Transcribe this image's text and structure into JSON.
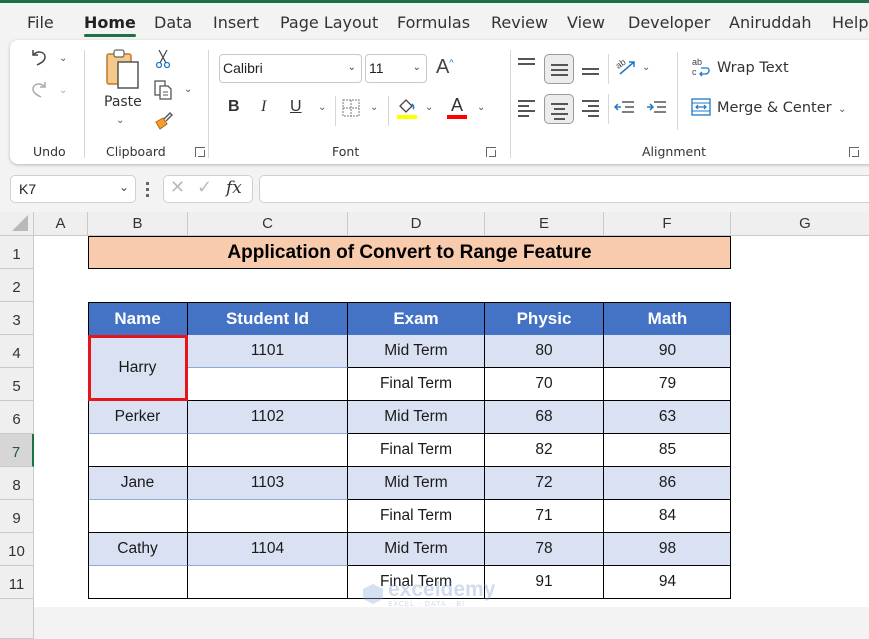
{
  "tabs": [
    {
      "label": "File",
      "active": false
    },
    {
      "label": "Home",
      "active": true
    },
    {
      "label": "Data",
      "active": false
    },
    {
      "label": "Insert",
      "active": false
    },
    {
      "label": "Page Layout",
      "active": false
    },
    {
      "label": "Formulas",
      "active": false
    },
    {
      "label": "Review",
      "active": false
    },
    {
      "label": "View",
      "active": false
    },
    {
      "label": "Developer",
      "active": false
    },
    {
      "label": "Aniruddah",
      "active": false
    },
    {
      "label": "Help",
      "active": false
    }
  ],
  "ribbon": {
    "undo": {
      "group_label": "Undo",
      "undo_icon": "undo-icon",
      "redo_icon": "redo-icon"
    },
    "clipboard": {
      "group_label": "Clipboard",
      "paste_label": "Paste",
      "cut_icon": "scissors-icon",
      "copy_icon": "copy-icon",
      "format_painter_icon": "paintbrush-icon"
    },
    "font": {
      "group_label": "Font",
      "font_name": "Calibri",
      "font_size": "11",
      "bold": "B",
      "italic": "I",
      "underline": "U",
      "grow_font": "A",
      "shrink_font": "A",
      "font_color_letter": "A",
      "fill_color": "#ffff00",
      "font_color": "#ff0000"
    },
    "alignment": {
      "group_label": "Alignment",
      "wrap_text_label": "Wrap Text",
      "merge_center_label": "Merge & Center",
      "orientation_glyph": "ab"
    }
  },
  "formula_bar": {
    "name_box": "K7",
    "fx_label": "fx",
    "formula_value": ""
  },
  "accent_color": "#1e7145",
  "columns": [
    "A",
    "B",
    "C",
    "D",
    "E",
    "F",
    "G"
  ],
  "rows": [
    "1",
    "2",
    "3",
    "4",
    "5",
    "6",
    "7",
    "8",
    "9",
    "10",
    "11"
  ],
  "selected_row": "7",
  "sheet": {
    "title": "Application of Convert to Range Feature",
    "headers": [
      "Name",
      "Student Id",
      "Exam",
      "Physic",
      "Math"
    ],
    "records": [
      {
        "name": "Harry",
        "id": "1101",
        "exams": [
          {
            "exam": "Mid Term",
            "physic": "80",
            "math": "90"
          },
          {
            "exam": "Final Term",
            "physic": "70",
            "math": "79"
          }
        ]
      },
      {
        "name": "Perker",
        "id": "1102",
        "exams": [
          {
            "exam": "Mid Term",
            "physic": "68",
            "math": "63"
          },
          {
            "exam": "Final Term",
            "physic": "82",
            "math": "85"
          }
        ]
      },
      {
        "name": "Jane",
        "id": "1103",
        "exams": [
          {
            "exam": "Mid Term",
            "physic": "72",
            "math": "86"
          },
          {
            "exam": "Final Term",
            "physic": "71",
            "math": "84"
          }
        ]
      },
      {
        "name": "Cathy",
        "id": "1104",
        "exams": [
          {
            "exam": "Mid Term",
            "physic": "78",
            "math": "98"
          },
          {
            "exam": "Final Term",
            "physic": "91",
            "math": "94"
          }
        ]
      }
    ],
    "header_color": "#4472c4",
    "band_color": "#d9e1f2",
    "title_color": "#f8cbad",
    "highlight_color": "#e8141b"
  },
  "watermark": {
    "brand": "exceldemy",
    "tagline": "EXCEL · DATA · BI"
  }
}
